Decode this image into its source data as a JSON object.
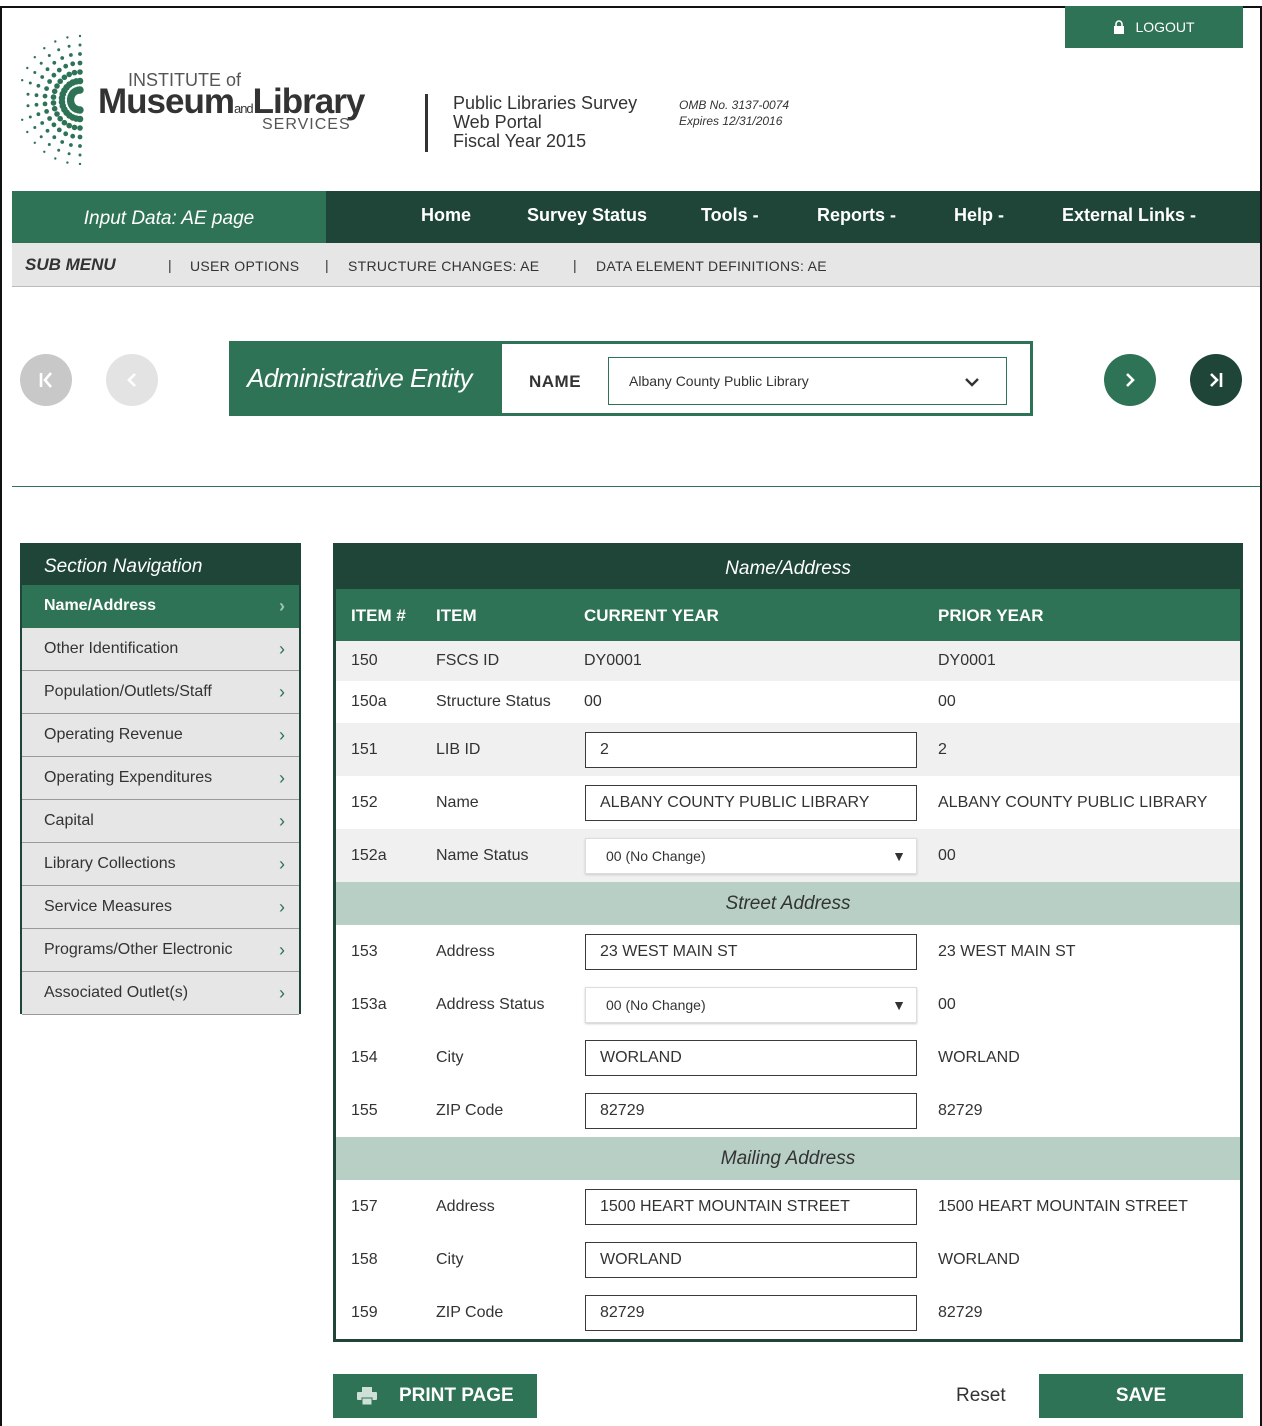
{
  "header": {
    "logout_label": "LOGOUT",
    "logo": {
      "line1": "INSTITUTE of",
      "museum": "Museum",
      "and": "and",
      "library": "Library",
      "services": "SERVICES"
    },
    "survey_line1": "Public Libraries Survey",
    "survey_line2": "Web Portal",
    "survey_line3": "Fiscal Year 2015",
    "omb_line1": "OMB No. 3137-0074",
    "omb_line2": "Expires 12/31/2016"
  },
  "nav": {
    "input_label": "Input Data: AE page",
    "items": [
      "Home",
      "Survey Status",
      "Tools -",
      "Reports -",
      "Help -",
      "External Links -"
    ]
  },
  "submenu": {
    "title": "SUB MENU",
    "links": [
      "USER OPTIONS",
      "STRUCTURE CHANGES: AE",
      "DATA ELEMENT DEFINITIONS: AE"
    ],
    "separator": "|"
  },
  "entity": {
    "title": "Administrative Entity",
    "name_label": "NAME",
    "selected": "Albany County Public Library"
  },
  "section_nav": {
    "title": "Section Navigation",
    "items": [
      "Name/Address",
      "Other Identification",
      "Population/Outlets/Staff",
      "Operating Revenue",
      "Operating Expenditures",
      "Capital",
      "Library Collections",
      "Service Measures",
      "Programs/Other Electronic",
      "Associated Outlet(s)"
    ]
  },
  "table": {
    "title": "Name/Address",
    "headers": {
      "item_no": "ITEM #",
      "item": "ITEM",
      "current": "CURRENT YEAR",
      "prior": "PRIOR YEAR"
    },
    "rows": [
      {
        "num": "150",
        "item": "FSCS ID",
        "current": "DY0001",
        "prior": "DY0001"
      },
      {
        "num": "150a",
        "item": "Structure Status",
        "current": "00",
        "prior": "00"
      },
      {
        "num": "151",
        "item": "LIB ID",
        "current": "2",
        "prior": "2"
      },
      {
        "num": "152",
        "item": "Name",
        "current": "ALBANY COUNTY PUBLIC LIBRARY",
        "prior": "ALBANY COUNTY PUBLIC LIBRARY"
      },
      {
        "num": "152a",
        "item": "Name Status",
        "current": "00 (No Change)",
        "prior": "00"
      }
    ],
    "street_header": "Street Address",
    "street_rows": [
      {
        "num": "153",
        "item": "Address",
        "current": "23 WEST MAIN ST",
        "prior": "23 WEST MAIN ST"
      },
      {
        "num": "153a",
        "item": "Address Status",
        "current": "00 (No Change)",
        "prior": "00"
      },
      {
        "num": "154",
        "item": "City",
        "current": "WORLAND",
        "prior": "WORLAND"
      },
      {
        "num": "155",
        "item": "ZIP Code",
        "current": "82729",
        "prior": "82729"
      }
    ],
    "mailing_header": "Mailing Address",
    "mailing_rows": [
      {
        "num": "157",
        "item": "Address",
        "current": "1500 HEART MOUNTAIN STREET",
        "prior": "1500 HEART MOUNTAIN STREET"
      },
      {
        "num": "158",
        "item": "City",
        "current": "WORLAND",
        "prior": "WORLAND"
      },
      {
        "num": "159",
        "item": "ZIP Code",
        "current": "82729",
        "prior": "82729"
      }
    ]
  },
  "actions": {
    "print_label": "PRINT PAGE",
    "reset_label": "Reset",
    "save_label": "SAVE"
  },
  "colors": {
    "primary": "#2e7355",
    "dark": "#1e4537",
    "subheader": "#b8cfc5",
    "light_gray": "#e6e6e6"
  }
}
